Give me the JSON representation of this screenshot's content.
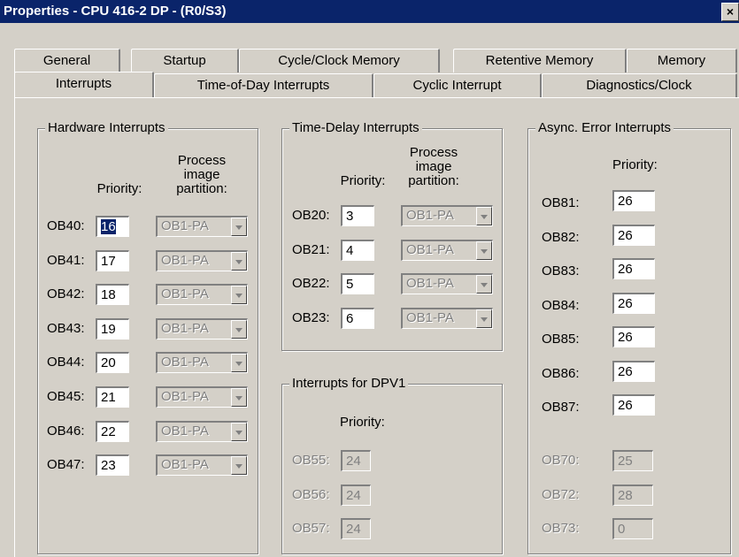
{
  "window": {
    "title": "Properties - CPU 416-2 DP - (R0/S3)",
    "close_glyph": "×"
  },
  "tabs_back": [
    "General",
    "Startup",
    "Cycle/Clock Memory",
    "Retentive Memory",
    "Memory"
  ],
  "tabs_front": [
    "Interrupts",
    "Time-of-Day Interrupts",
    "Cyclic Interrupt",
    "Diagnostics/Clock"
  ],
  "hardware": {
    "legend": "Hardware Interrupts",
    "priority_header": "Priority:",
    "partition_header_1": "Process",
    "partition_header_2": "image",
    "partition_header_3": "partition:",
    "rows": [
      {
        "ob": "OB40:",
        "priority": "16",
        "partition": "OB1-PA"
      },
      {
        "ob": "OB41:",
        "priority": "17",
        "partition": "OB1-PA"
      },
      {
        "ob": "OB42:",
        "priority": "18",
        "partition": "OB1-PA"
      },
      {
        "ob": "OB43:",
        "priority": "19",
        "partition": "OB1-PA"
      },
      {
        "ob": "OB44:",
        "priority": "20",
        "partition": "OB1-PA"
      },
      {
        "ob": "OB45:",
        "priority": "21",
        "partition": "OB1-PA"
      },
      {
        "ob": "OB46:",
        "priority": "22",
        "partition": "OB1-PA"
      },
      {
        "ob": "OB47:",
        "priority": "23",
        "partition": "OB1-PA"
      }
    ]
  },
  "time_delay": {
    "legend": "Time-Delay Interrupts",
    "priority_header": "Priority:",
    "partition_header_1": "Process",
    "partition_header_2": "image",
    "partition_header_3": "partition:",
    "rows": [
      {
        "ob": "OB20:",
        "priority": "3",
        "partition": "OB1-PA"
      },
      {
        "ob": "OB21:",
        "priority": "4",
        "partition": "OB1-PA"
      },
      {
        "ob": "OB22:",
        "priority": "5",
        "partition": "OB1-PA"
      },
      {
        "ob": "OB23:",
        "priority": "6",
        "partition": "OB1-PA"
      }
    ]
  },
  "dpv1": {
    "legend": "Interrupts for DPV1",
    "priority_header": "Priority:",
    "rows": [
      {
        "ob": "OB55:",
        "priority": "24"
      },
      {
        "ob": "OB56:",
        "priority": "24"
      },
      {
        "ob": "OB57:",
        "priority": "24"
      }
    ]
  },
  "async": {
    "legend": "Async. Error Interrupts",
    "priority_header": "Priority:",
    "rows": [
      {
        "ob": "OB81:",
        "priority": "26"
      },
      {
        "ob": "OB82:",
        "priority": "26"
      },
      {
        "ob": "OB83:",
        "priority": "26"
      },
      {
        "ob": "OB84:",
        "priority": "26"
      },
      {
        "ob": "OB85:",
        "priority": "26"
      },
      {
        "ob": "OB86:",
        "priority": "26"
      },
      {
        "ob": "OB87:",
        "priority": "26"
      }
    ],
    "disabled_rows": [
      {
        "ob": "OB70:",
        "priority": "25"
      },
      {
        "ob": "OB72:",
        "priority": "28"
      },
      {
        "ob": "OB73:",
        "priority": "0"
      }
    ]
  }
}
